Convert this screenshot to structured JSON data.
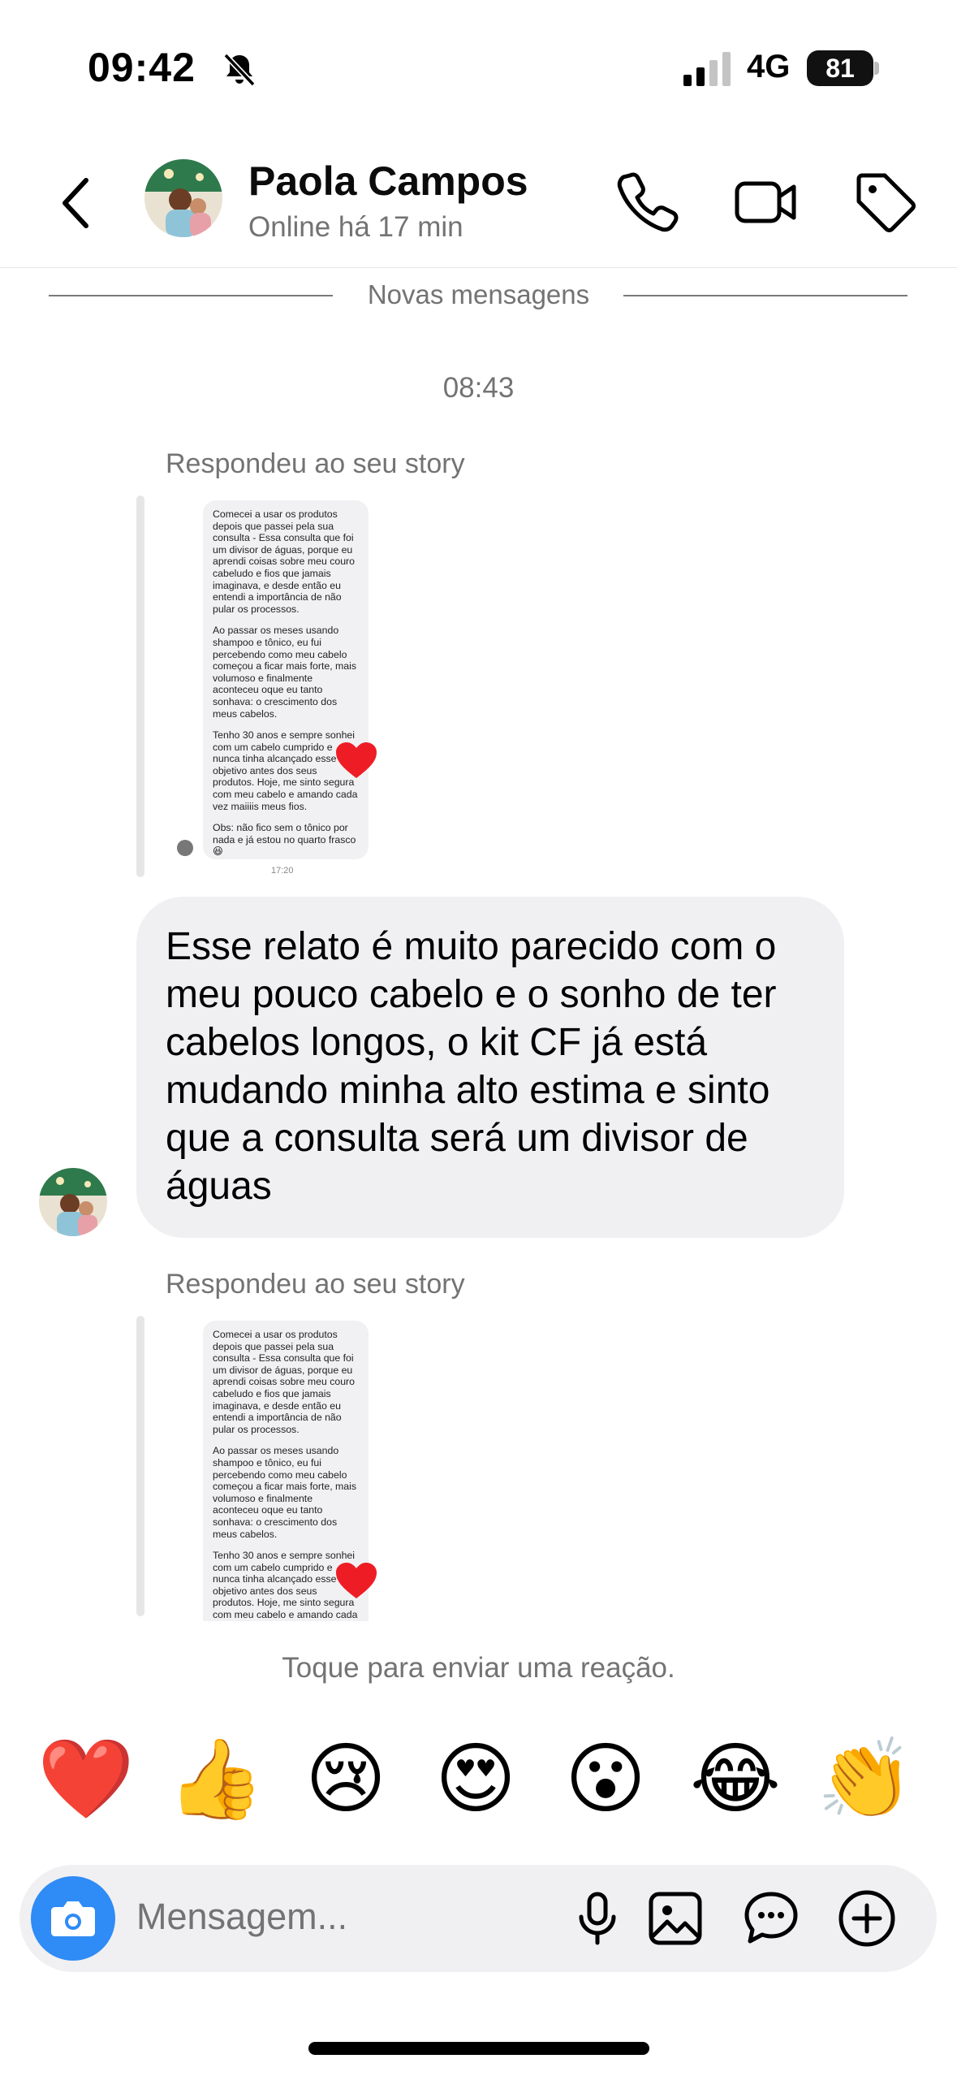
{
  "status_bar": {
    "time": "09:42",
    "network": "4G",
    "battery": "81"
  },
  "header": {
    "contact_name": "Paola Campos",
    "status": "Online há 17 min"
  },
  "divider_label": "Novas mensagens",
  "timestamp": "08:43",
  "replied_label": "Respondeu ao seu story",
  "story": {
    "paragraphs": [
      "Comecei a usar os produtos depois que passei pela sua consulta - Essa consulta que foi um divisor de águas, porque eu aprendi coisas sobre meu couro cabeludo e fios que jamais imaginava, e desde então eu entendi a importância de não pular os processos.",
      "Ao passar os meses usando shampoo e tônico, eu fui percebendo como meu cabelo começou a ficar mais forte, mais volumoso e finalmente aconteceu oque eu tanto sonhava: o crescimento dos meus cabelos.",
      "Tenho 30 anos e sempre sonhei com um cabelo cumprido e nunca tinha alcançado esse objetivo antes dos seus produtos. Hoje, me sinto segura com meu cabelo e amando cada vez maiiiis meus fios.",
      "Obs: não fico sem o tônico por nada e já estou no quarto frasco 😆"
    ],
    "time": "17:20"
  },
  "message": {
    "text": "Esse relato é muito parecido com o meu pouco cabelo e o sonho de ter cabelos longos, o kit CF já está mudando minha alto estima e sinto que a consulta será um divisor de águas"
  },
  "reaction_hint": "Toque para enviar uma reação.",
  "reactions": [
    "❤️",
    "👍",
    "😢",
    "😍",
    "😮",
    "😂",
    "👏"
  ],
  "composer": {
    "placeholder": "Mensagem..."
  },
  "colors": {
    "accent": "#2f8bf5",
    "bubble": "#f0f0f2",
    "secondary_text": "#737373",
    "heart": "#ee1d25"
  },
  "icons": [
    "bell-slash-icon",
    "signal-icon",
    "back-chevron-icon",
    "phone-icon",
    "video-icon",
    "tag-icon",
    "camera-icon",
    "microphone-icon",
    "image-icon",
    "sticker-icon",
    "plus-icon"
  ]
}
